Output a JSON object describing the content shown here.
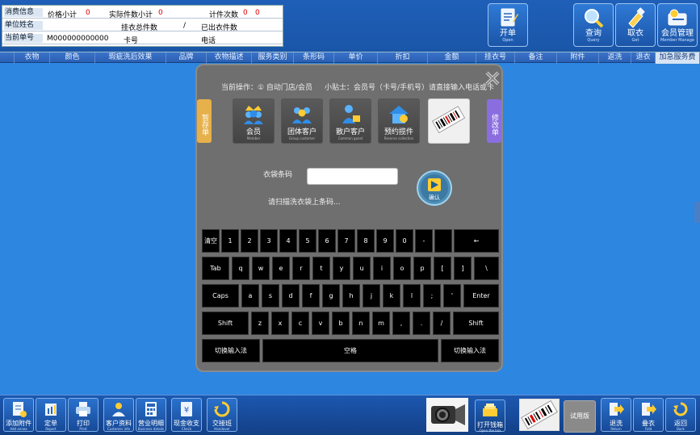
{
  "info": {
    "row1": {
      "label": "消费信息",
      "price_total_label": "价格小计",
      "price_total_value": "0",
      "qty_total_label": "实际件数小计",
      "qty_total_value": "0",
      "wash_label": "计件次数",
      "wash_value": "0",
      "wash_extra": "0"
    },
    "row2": {
      "label": "单位姓名",
      "in_store_label": "挂衣总件数",
      "in_store_sep": "/",
      "out_label": "已出衣件数"
    },
    "row3": {
      "label": "当前单号",
      "order_no": "M000000000000",
      "card_label": "卡号",
      "phone_label": "电话"
    }
  },
  "top_buttons": {
    "kaidan": {
      "label": "开单",
      "sub": "Open"
    },
    "query": {
      "label": "查询",
      "sub": "Query"
    },
    "takeout": {
      "label": "取衣",
      "sub": "Get"
    },
    "member": {
      "label": "会员管理",
      "sub": "Member Manage"
    }
  },
  "columns": [
    "衣物",
    "颜色",
    "瑕疵洗后效果",
    "品牌",
    "衣物描述",
    "服务类别",
    "条形码",
    "单价",
    "折扣",
    "金额",
    "挂衣号",
    "备注",
    "附件",
    "返洗",
    "退衣",
    "加急服务费"
  ],
  "dialog": {
    "side_left": "暂存单",
    "side_right": "修改单",
    "select_text": "当前操作：① 自动门店/会员",
    "hint_text": "小贴士：会员号（卡号/手机号）请直接输入电话或卡",
    "modes": [
      {
        "label": "会员",
        "sub": "Member",
        "active": false
      },
      {
        "label": "团体客户",
        "sub": "Group customer",
        "active": false
      },
      {
        "label": "散户客户",
        "sub": "Common guest",
        "active": false
      },
      {
        "label": "预约揽件",
        "sub": "Reserve collection",
        "active": false
      },
      {
        "label": "",
        "sub": "",
        "active": true
      }
    ],
    "barcode_label": "衣袋条码",
    "barcode_value": "",
    "scan_hint": "请扫描洗衣袋上条码...",
    "go_label": "确认"
  },
  "keyboard": {
    "row1": [
      "清空",
      "1",
      "2",
      "3",
      "4",
      "5",
      "6",
      "7",
      "8",
      "9",
      "0",
      "-",
      "",
      "←"
    ],
    "row2": [
      "Tab",
      "q",
      "w",
      "e",
      "r",
      "t",
      "y",
      "u",
      "i",
      "o",
      "p",
      "[",
      "]",
      "\\"
    ],
    "row3": [
      "Caps",
      "a",
      "s",
      "d",
      "f",
      "g",
      "h",
      "j",
      "k",
      "l",
      ";",
      "'",
      "Enter"
    ],
    "row4": [
      "Shift",
      "z",
      "x",
      "c",
      "v",
      "b",
      "n",
      "m",
      ",",
      ".",
      "/",
      "Shift"
    ],
    "row5": [
      "切换输入法",
      "空格",
      "切换输入法"
    ]
  },
  "bottom_buttons": [
    {
      "label": "添加附件",
      "sub": "Add annex"
    },
    {
      "label": "定单",
      "sub": "Report"
    },
    {
      "label": "打印",
      "sub": "Print"
    },
    {
      "label": "客户资料",
      "sub": "Customer info"
    },
    {
      "label": "营业明细",
      "sub": "Business details"
    },
    {
      "label": "现金收支",
      "sub": "Check"
    },
    {
      "label": "交接班",
      "sub": "Handover"
    }
  ],
  "bottom_right": {
    "open_cash_label": "打开钱箱",
    "open_cash_sub": "Open the box",
    "trial_label": "试用版",
    "return_label": "退洗",
    "return_sub": "Return",
    "fold_label": "叠衣",
    "fold_sub": "Fold",
    "back_label": "返回",
    "back_sub": "Back"
  }
}
